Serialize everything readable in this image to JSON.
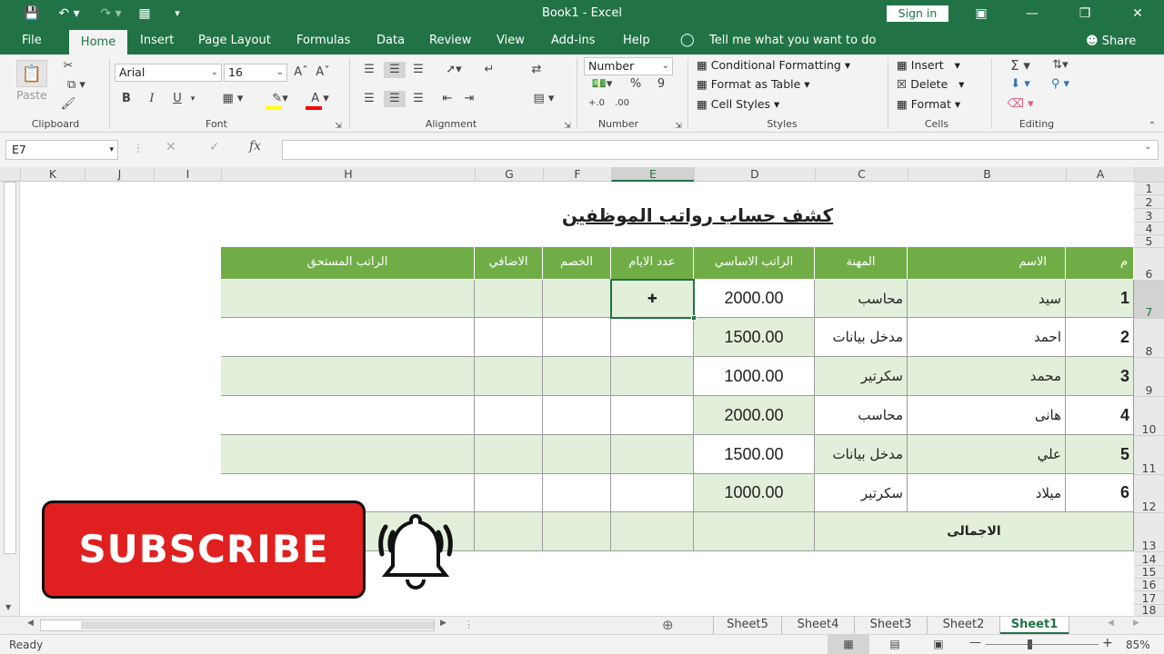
{
  "window": {
    "title": "Book1  -  Excel",
    "sign_in": "Sign in"
  },
  "tabs": [
    {
      "label": "File"
    },
    {
      "label": "Home",
      "active": true
    },
    {
      "label": "Insert"
    },
    {
      "label": "Page Layout"
    },
    {
      "label": "Formulas"
    },
    {
      "label": "Data"
    },
    {
      "label": "Review"
    },
    {
      "label": "View"
    },
    {
      "label": "Add-ins"
    },
    {
      "label": "Help"
    }
  ],
  "tell_me": "Tell me what you want to do",
  "share": "Share",
  "ribbon": {
    "clipboard": {
      "label": "Clipboard",
      "paste": "Paste"
    },
    "font": {
      "label": "Font",
      "name": "Arial",
      "size": "16",
      "bold": "B",
      "italic": "I",
      "underline": "U"
    },
    "alignment": {
      "label": "Alignment"
    },
    "number": {
      "label": "Number",
      "format": "Number",
      "percent": "%",
      "comma": "9"
    },
    "styles": {
      "label": "Styles",
      "conditional": "Conditional Formatting",
      "format_table": "Format as Table",
      "cell_styles": "Cell Styles"
    },
    "cells": {
      "label": "Cells",
      "insert": "Insert",
      "delete": "Delete",
      "format": "Format"
    },
    "editing": {
      "label": "Editing"
    }
  },
  "formula_bar": {
    "name_box": "E7",
    "fx": "fx",
    "value": ""
  },
  "columns": [
    "K",
    "J",
    "I",
    "H",
    "G",
    "F",
    "E",
    "D",
    "C",
    "B",
    "A"
  ],
  "rows": [
    "1",
    "2",
    "3",
    "4",
    "5",
    "6",
    "7",
    "8",
    "9",
    "10",
    "11",
    "12",
    "13",
    "14",
    "15",
    "16",
    "17",
    "18"
  ],
  "sheet": {
    "title": "كشف حساب رواتب الموظفين",
    "headers": {
      "index": "م",
      "name": "الاسم",
      "job": "المهنة",
      "basic": "الراتب الاساسي",
      "days": "عدد الايام",
      "deduction": "الخصم",
      "extra": "الاضافي",
      "due": "الراتب المستحق"
    },
    "employees": [
      {
        "index": "1",
        "name": "سيد",
        "job": "محاسب",
        "basic": "2000.00"
      },
      {
        "index": "2",
        "name": "احمد",
        "job": "مدخل بيانات",
        "basic": "1500.00"
      },
      {
        "index": "3",
        "name": "محمد",
        "job": "سكرتير",
        "basic": "1000.00"
      },
      {
        "index": "4",
        "name": "هانى",
        "job": "محاسب",
        "basic": "2000.00"
      },
      {
        "index": "5",
        "name": "علي",
        "job": "مدخل بيانات",
        "basic": "1500.00"
      },
      {
        "index": "6",
        "name": "ميلاد",
        "job": "سكرتير",
        "basic": "1000.00"
      }
    ],
    "total_label": "الاجمالى"
  },
  "sheet_tabs": [
    {
      "label": "Sheet5"
    },
    {
      "label": "Sheet4"
    },
    {
      "label": "Sheet3"
    },
    {
      "label": "Sheet2"
    },
    {
      "label": "Sheet1",
      "active": true
    }
  ],
  "status": {
    "ready": "Ready",
    "zoom": "85%"
  },
  "overlay": {
    "subscribe": "SUBSCRIBE"
  },
  "colors": {
    "accent": "#217346",
    "header_green": "#70ad47",
    "band_green": "#e2efda",
    "subscribe_red": "#e02020"
  }
}
